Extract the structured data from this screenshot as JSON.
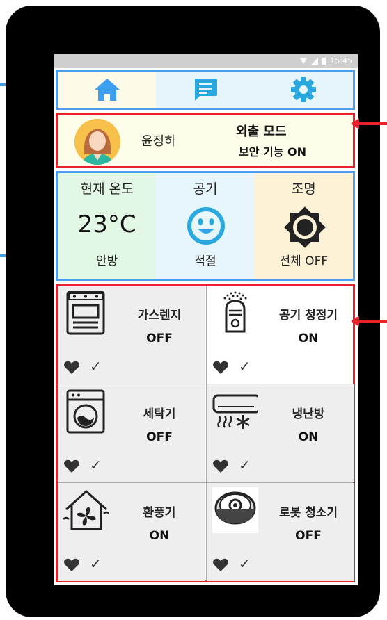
{
  "statusbar": {
    "time": "15:45"
  },
  "nav": {
    "items": [
      {
        "label": "home",
        "icon": "home-icon"
      },
      {
        "label": "messages",
        "icon": "message-icon"
      },
      {
        "label": "settings",
        "icon": "gear-icon"
      }
    ]
  },
  "profile": {
    "name": "윤정하",
    "mode": "외출 모드",
    "security": "보안 기능 ON"
  },
  "status": {
    "temperature": {
      "label": "현재 온도",
      "value": "23°C",
      "room": "안방"
    },
    "air": {
      "label": "공기",
      "value": "적절",
      "icon": "smiley-icon"
    },
    "lighting": {
      "label": "조명",
      "value": "전체 OFF",
      "icon": "brightness-icon"
    }
  },
  "devices": [
    {
      "name": "가스렌지",
      "state": "OFF",
      "icon": "stove-icon"
    },
    {
      "name": "공기 청정기",
      "state": "ON",
      "icon": "air-purifier-icon"
    },
    {
      "name": "세탁기",
      "state": "OFF",
      "icon": "washing-machine-icon"
    },
    {
      "name": "냉난방",
      "state": "ON",
      "icon": "air-conditioner-icon"
    },
    {
      "name": "환풍기",
      "state": "ON",
      "icon": "ventilator-icon"
    },
    {
      "name": "로봇 청소기",
      "state": "OFF",
      "icon": "robot-vacuum-icon"
    }
  ],
  "colors": {
    "blue_frame": "#4a9ef0",
    "red_frame": "#e8212a",
    "home_icon": "#3c9ff0",
    "message_icon": "#29a8df",
    "gear_icon": "#29a8df"
  }
}
